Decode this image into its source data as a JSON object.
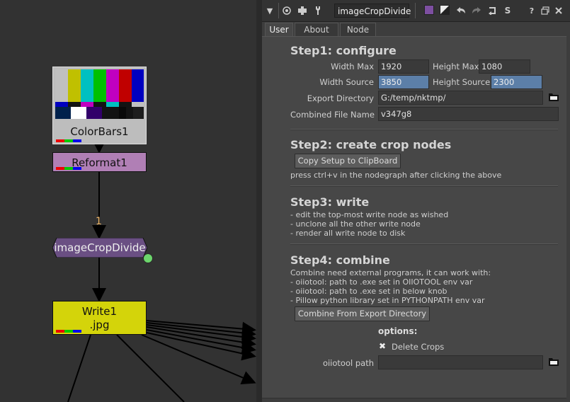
{
  "nodegraph": {
    "colorbars_label": "ColorBars1",
    "reformat_label": "Reformat1",
    "input_number": "1",
    "imagecropdivide_label": "imageCropDivide",
    "write_label_line1": "Write1",
    "write_label_line2": ".jpg"
  },
  "titlebar": {
    "node_name": "imageCropDivide",
    "help_label": "?"
  },
  "tabs": [
    {
      "label": "User"
    },
    {
      "label": "About"
    },
    {
      "label": "Node"
    }
  ],
  "step1": {
    "heading": "Step1: configure",
    "width_max_label": "Width Max",
    "width_max_value": "1920",
    "height_max_label": "Height Max",
    "height_max_value": "1080",
    "width_source_label": "Width Source",
    "width_source_value": "3850",
    "height_source_label": "Height Source",
    "height_source_value": "2300",
    "export_dir_label": "Export Directory",
    "export_dir_value": "G:/temp/nktmp/",
    "combined_name_label": "Combined File Name",
    "combined_name_value": "v347g8"
  },
  "step2": {
    "heading": "Step2: create crop nodes",
    "button_label": "Copy Setup to ClipBoard",
    "note": "press ctrl+v in the nodegraph after clicking the above"
  },
  "step3": {
    "heading": "Step3: write",
    "lines": [
      "- edit the top-most write node as wished",
      "- unclone all the other write node",
      "- render all write node to disk"
    ]
  },
  "step4": {
    "heading": "Step4: combine",
    "lines": [
      "Combine need external programs, it can work with:",
      "- oiiotool: path to .exe set in OIIOTOOL env var",
      "- oiiotool: path to .exe set in below knob",
      "- Pillow python library set in PYTHONPATH env var"
    ],
    "button_label": "Combine From Export Directory",
    "options_label": "options:",
    "delete_crops_mark": "✖",
    "delete_crops_label": "Delete Crops",
    "oiiotool_label": "oiiotool path",
    "oiiotool_value": ""
  },
  "colors": {
    "reformat": "#b07fb5",
    "write": "#d4d40a",
    "imagecropdivide": "#6a4f83",
    "highlight_field": "#5c7fa8"
  }
}
